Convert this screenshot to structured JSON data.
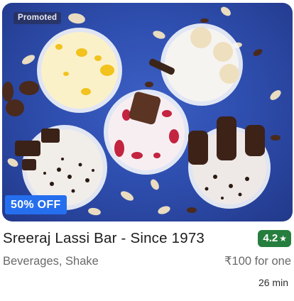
{
  "restaurant": {
    "promoted_label": "Promoted",
    "offer_label": "50% OFF",
    "name": "Sreeraj Lassi Bar - Since 1973",
    "rating": "4.2",
    "rating_icon": "star-icon",
    "cuisines": "Beverages, Shake",
    "price_for_one": "₹100 for one",
    "delivery_time": "26 min"
  },
  "colors": {
    "rating_badge": "#267e3e",
    "offer_badge": "#256fef",
    "photo_background": "#2f4fb0"
  }
}
